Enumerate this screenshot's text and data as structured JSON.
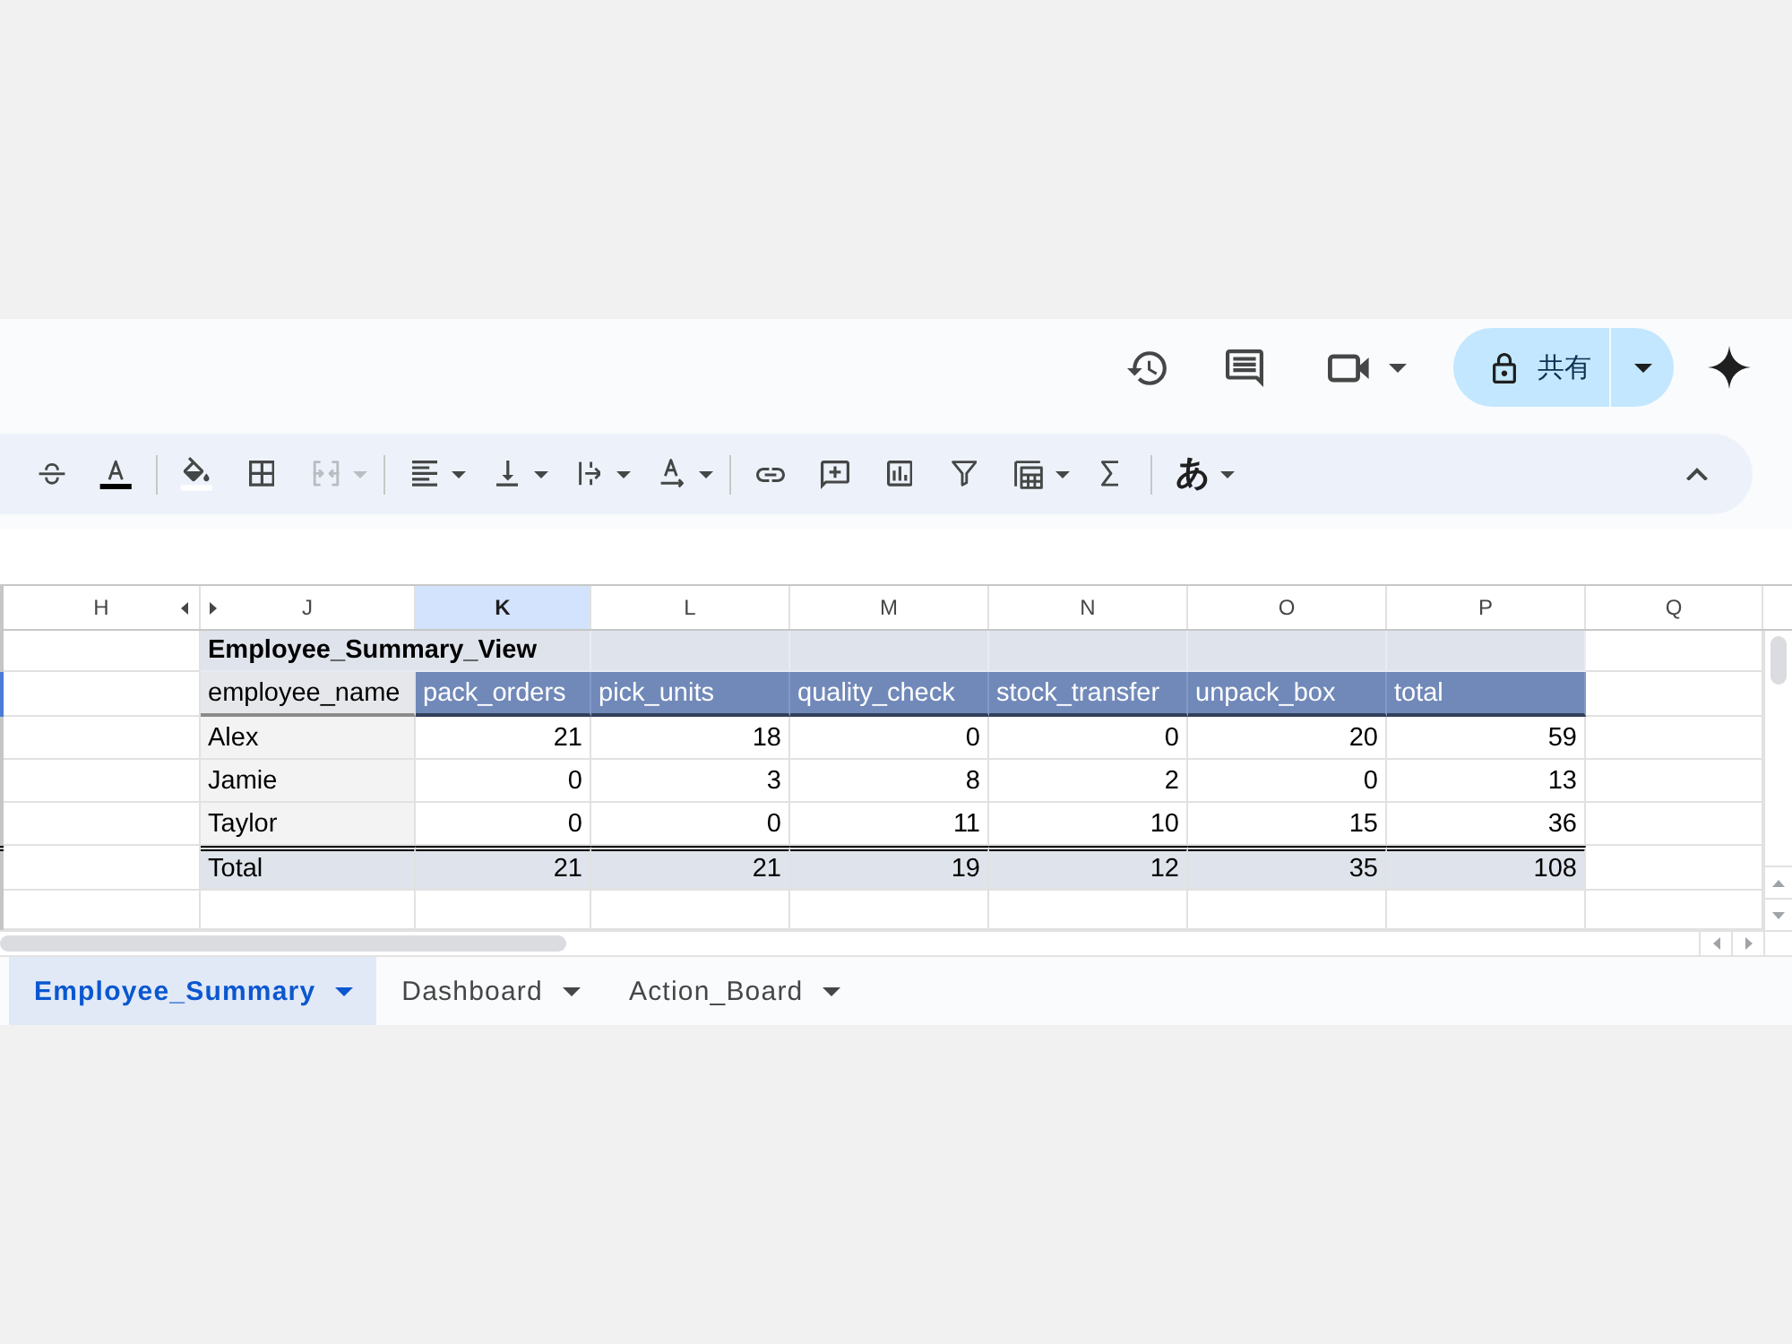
{
  "top_bar": {
    "share": {
      "label": "共有"
    }
  },
  "toolbar": {
    "groups": [
      [
        {
          "kind": "strikethrough",
          "disabled": false
        },
        {
          "kind": "text_color",
          "disabled": false,
          "color": "#000000"
        }
      ],
      [
        {
          "kind": "fill_color",
          "disabled": false,
          "color": "#ffffff"
        },
        {
          "kind": "borders",
          "disabled": false
        },
        {
          "kind": "merge",
          "disabled": true
        }
      ],
      [
        {
          "kind": "align",
          "disabled": false
        },
        {
          "kind": "valign",
          "disabled": false
        },
        {
          "kind": "wrap",
          "disabled": false
        },
        {
          "kind": "rotate",
          "disabled": false
        }
      ],
      [
        {
          "kind": "link",
          "disabled": false
        },
        {
          "kind": "comment",
          "disabled": false
        },
        {
          "kind": "chart",
          "disabled": false
        },
        {
          "kind": "filter",
          "disabled": false
        },
        {
          "kind": "table",
          "disabled": false
        },
        {
          "kind": "functions",
          "disabled": false
        }
      ],
      [
        {
          "kind": "input_tools",
          "label": "あ",
          "disabled": false
        }
      ]
    ]
  },
  "grid": {
    "columns": [
      {
        "label": "H",
        "selected": false,
        "hidden_after": true
      },
      {
        "label": "J",
        "selected": false,
        "hidden_after": false
      },
      {
        "label": "K",
        "selected": true,
        "hidden_after": false
      },
      {
        "label": "L",
        "selected": false,
        "hidden_after": false
      },
      {
        "label": "M",
        "selected": false,
        "hidden_after": false
      },
      {
        "label": "N",
        "selected": false,
        "hidden_after": false
      },
      {
        "label": "O",
        "selected": false,
        "hidden_after": false
      },
      {
        "label": "P",
        "selected": false,
        "hidden_after": false
      },
      {
        "label": "Q",
        "selected": false,
        "hidden_after": false
      }
    ],
    "rows": [
      {
        "kind": "title",
        "selected": false,
        "cells": [
          "Employee_Summary_View"
        ]
      },
      {
        "kind": "header",
        "selected": true,
        "cells": [
          "employee_name",
          "pack_orders",
          "pick_units",
          "quality_check",
          "stock_transfer",
          "unpack_box",
          "total"
        ]
      },
      {
        "kind": "data",
        "selected": false,
        "cells": [
          "Alex",
          "21",
          "18",
          "0",
          "0",
          "20",
          "59"
        ]
      },
      {
        "kind": "data",
        "selected": false,
        "cells": [
          "Jamie",
          "0",
          "3",
          "8",
          "2",
          "0",
          "13"
        ]
      },
      {
        "kind": "data",
        "selected": false,
        "cells": [
          "Taylor",
          "0",
          "0",
          "11",
          "10",
          "15",
          "36"
        ]
      },
      {
        "kind": "total",
        "selected": false,
        "cells": [
          "Total",
          "21",
          "21",
          "19",
          "12",
          "35",
          "108"
        ]
      },
      {
        "kind": "empty",
        "selected": false
      }
    ]
  },
  "sheet_tabs": [
    {
      "label": "Employee_Summary",
      "selected": true
    },
    {
      "label": "Dashboard",
      "selected": false
    },
    {
      "label": "Action_Board",
      "selected": false
    }
  ]
}
